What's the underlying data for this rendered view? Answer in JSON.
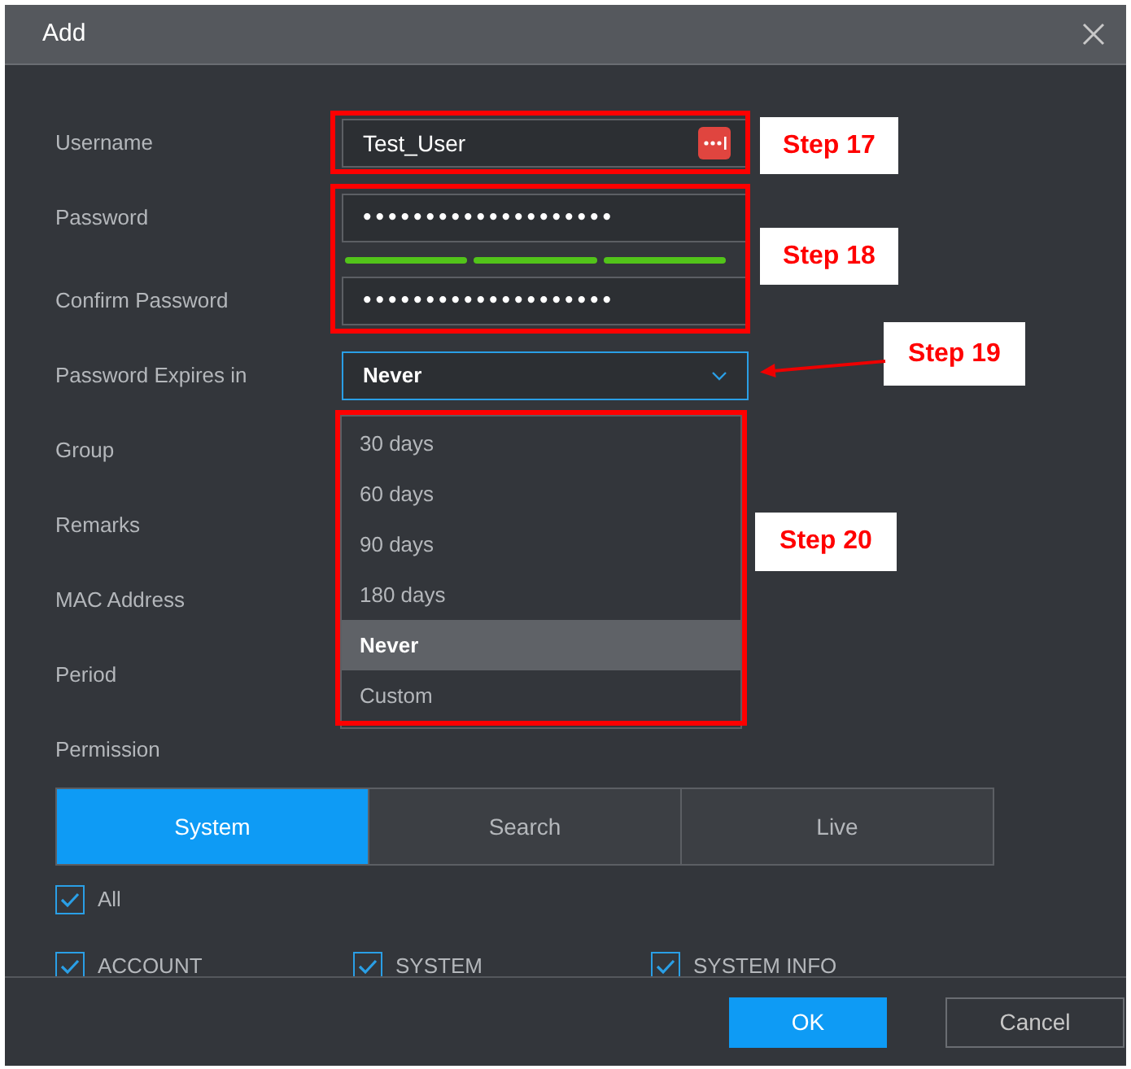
{
  "window": {
    "title": "Add"
  },
  "form": {
    "username": {
      "label": "Username",
      "value": "Test_User"
    },
    "password": {
      "label": "Password",
      "value": "••••••••••••••••••••"
    },
    "strength": {
      "segments": [
        {
          "on": true
        },
        {
          "on": true
        },
        {
          "on": true
        }
      ]
    },
    "confirm_password": {
      "label": "Confirm Password",
      "value": "••••••••••••••••••••"
    },
    "expires": {
      "label": "Password Expires in",
      "value": "Never",
      "expanded": true,
      "options": [
        {
          "label": "30 days",
          "selected": false
        },
        {
          "label": "60 days",
          "selected": false
        },
        {
          "label": "90 days",
          "selected": false
        },
        {
          "label": "180 days",
          "selected": false
        },
        {
          "label": "Never",
          "selected": true
        },
        {
          "label": "Custom",
          "selected": false
        }
      ]
    },
    "other_labels": [
      "Group",
      "Remarks",
      "MAC Address",
      "Period"
    ]
  },
  "permission": {
    "label": "Permission",
    "tabs": [
      {
        "label": "System",
        "selected": true
      },
      {
        "label": "Search",
        "selected": false
      },
      {
        "label": "Live",
        "selected": false
      }
    ],
    "all": {
      "label": "All",
      "checked": true
    },
    "items": [
      {
        "label": "ACCOUNT",
        "checked": true
      },
      {
        "label": "SYSTEM",
        "checked": true
      },
      {
        "label": "SYSTEM INFO",
        "checked": true
      }
    ]
  },
  "buttons": [
    {
      "label": "OK",
      "kind": "primary"
    },
    {
      "label": "Cancel",
      "kind": "secondary"
    }
  ],
  "annotations": [
    {
      "text": "Step 17"
    },
    {
      "text": "Step 18"
    },
    {
      "text": "Step 19"
    },
    {
      "text": "Step 20"
    }
  ]
}
